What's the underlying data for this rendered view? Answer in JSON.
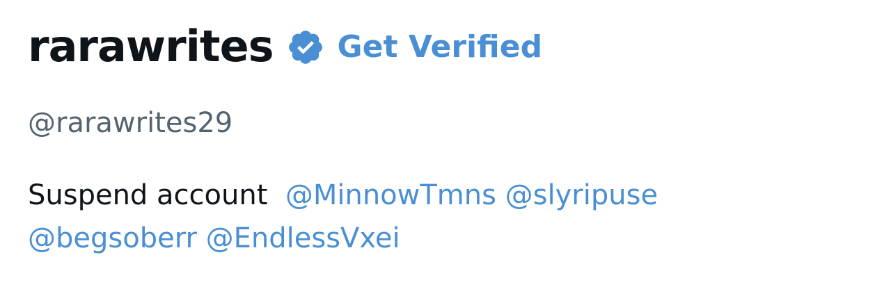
{
  "profile": {
    "display_name": "rarawrites",
    "verified_icon": "verified-badge-icon",
    "get_verified_label": "Get Verified",
    "handle": "@rarawrites29",
    "bio": {
      "text": "Suspend account",
      "mentions": [
        "@MinnowTmns",
        "@slyripuse",
        "@begsoberr",
        "@EndlessVxei"
      ]
    }
  },
  "colors": {
    "text_primary": "#0f1419",
    "text_secondary": "#536471",
    "accent": "#4a8fd4"
  }
}
